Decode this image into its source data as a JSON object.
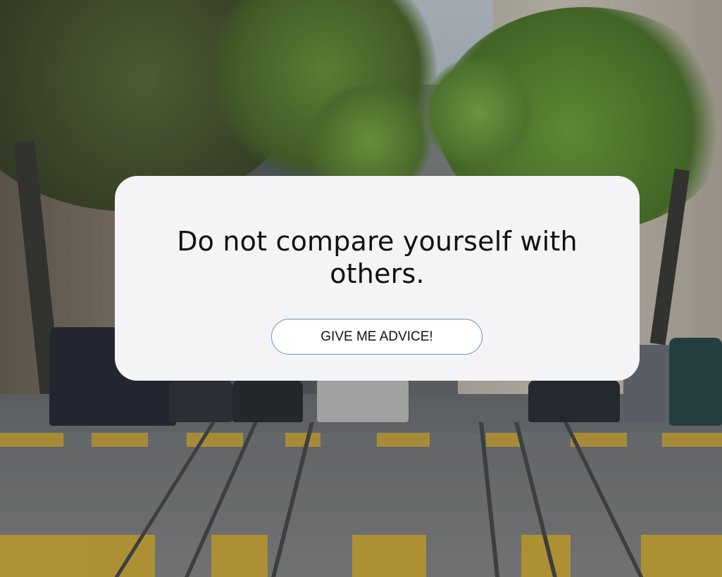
{
  "quote": {
    "text": "Do not compare yourself with others."
  },
  "actions": {
    "advice_button_label": "GIVE ME ADVICE!"
  },
  "theme": {
    "card_background": "#f4f4f6",
    "button_border": "#6a8fc8",
    "text_color": "#111111"
  },
  "background": {
    "image_subject": "city street with cable car tracks, trees and parked cars"
  }
}
